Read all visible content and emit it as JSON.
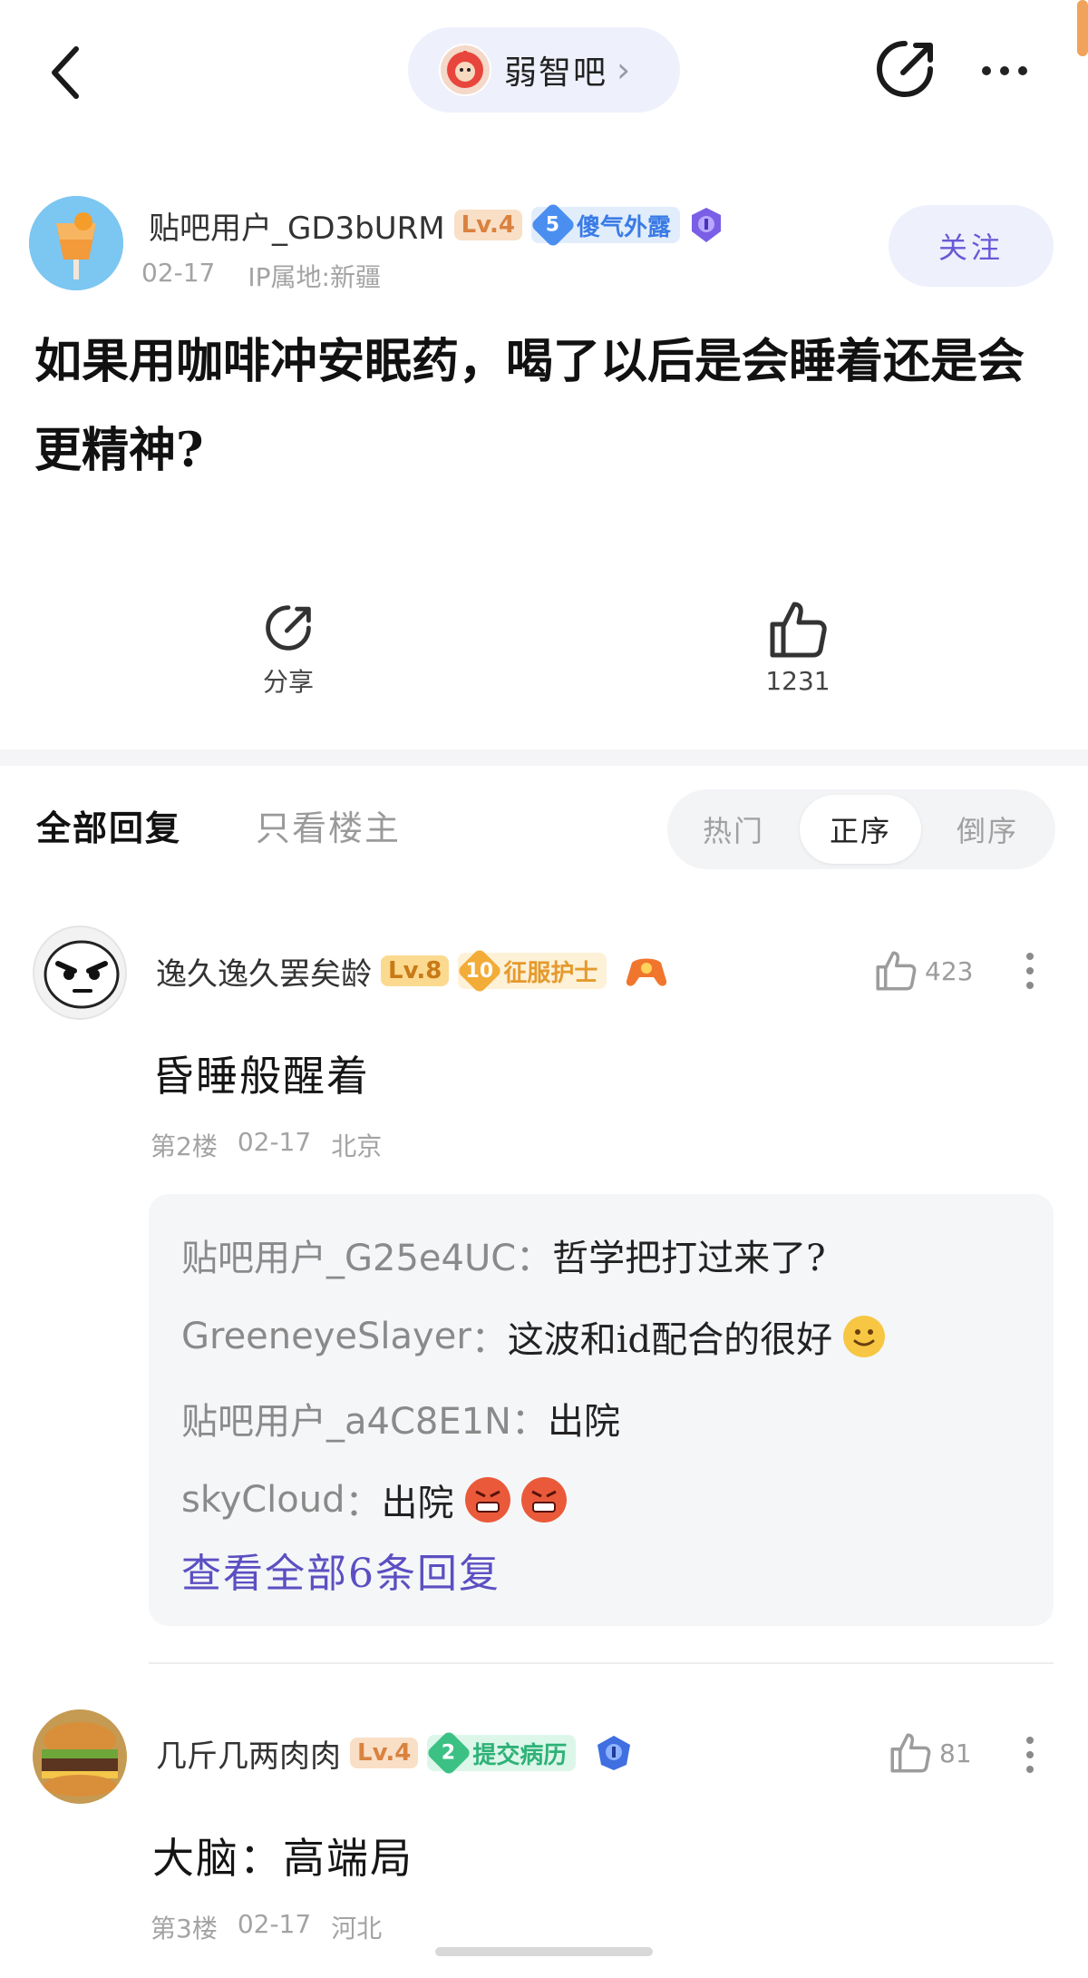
{
  "nav": {
    "forum_name": "弱智吧",
    "forum_chevron": "›"
  },
  "post": {
    "author": {
      "username": "贴吧用户_GD3bURM",
      "level": "Lv.4",
      "badge_num": "5",
      "badge_label": "傻气外露",
      "date": "02-17",
      "ip": "IP属地:新疆"
    },
    "follow_label": "关注",
    "title": "如果用咖啡冲安眠药，喝了以后是会睡着还是会更精神?",
    "share_label": "分享",
    "like_count": "1231"
  },
  "tabs": {
    "all_replies": "全部回复",
    "op_only": "只看楼主",
    "sort": [
      "热门",
      "正序",
      "倒序"
    ],
    "sort_active": "正序"
  },
  "replies": [
    {
      "username": "逸久逸久罢矣龄",
      "level": "Lv.8",
      "badge_num": "10",
      "badge_label": "征服护士",
      "likes": "423",
      "content": "昏睡般醒着",
      "floor": "第2楼",
      "date": "02-17",
      "location": "北京",
      "sub_replies": [
        {
          "user": "贴吧用户_G25e4UC",
          "sep": "：",
          "text": "哲学把打过来了?"
        },
        {
          "user": "GreeneyeSlayer",
          "sep": "：",
          "text": "这波和id配合的很好"
        },
        {
          "user": "贴吧用户_a4C8E1N",
          "sep": "：",
          "text": "出院"
        },
        {
          "user": "skyCloud",
          "sep": "：",
          "text": "出院"
        }
      ],
      "view_all": "查看全部6条回复"
    },
    {
      "username": "几斤几两肉肉",
      "level": "Lv.4",
      "badge_num": "2",
      "badge_label": "提交病历",
      "likes": "81",
      "content": "大脑：高端局",
      "floor": "第3楼",
      "date": "02-17",
      "location": "河北"
    }
  ],
  "colors": {
    "accent": "#6a58d6",
    "pill_bg": "#eef0fc",
    "link": "#5b4fc2",
    "level_bg": "#f9dfc6"
  }
}
